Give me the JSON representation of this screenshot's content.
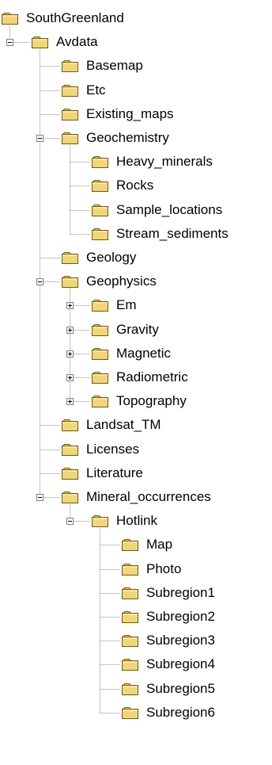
{
  "tree": {
    "colors": {
      "folder_fill": "#f1d678",
      "folder_outline": "#6f5a12",
      "line": "#8a8a8a",
      "text": "#000000"
    },
    "nodes": [
      {
        "label": "SouthGreenland",
        "depth": 0,
        "expander": "none"
      },
      {
        "label": "Avdata",
        "depth": 1,
        "expander": "expanded"
      },
      {
        "label": "Basemap",
        "depth": 2,
        "expander": "none"
      },
      {
        "label": "Etc",
        "depth": 2,
        "expander": "none"
      },
      {
        "label": "Existing_maps",
        "depth": 2,
        "expander": "none"
      },
      {
        "label": "Geochemistry",
        "depth": 2,
        "expander": "expanded"
      },
      {
        "label": "Heavy_minerals",
        "depth": 3,
        "expander": "none"
      },
      {
        "label": "Rocks",
        "depth": 3,
        "expander": "none"
      },
      {
        "label": "Sample_locations",
        "depth": 3,
        "expander": "none"
      },
      {
        "label": "Stream_sediments",
        "depth": 3,
        "expander": "none"
      },
      {
        "label": "Geology",
        "depth": 2,
        "expander": "none"
      },
      {
        "label": "Geophysics",
        "depth": 2,
        "expander": "expanded"
      },
      {
        "label": "Em",
        "depth": 3,
        "expander": "collapsed"
      },
      {
        "label": "Gravity",
        "depth": 3,
        "expander": "collapsed"
      },
      {
        "label": "Magnetic",
        "depth": 3,
        "expander": "collapsed"
      },
      {
        "label": "Radiometric",
        "depth": 3,
        "expander": "collapsed"
      },
      {
        "label": "Topography",
        "depth": 3,
        "expander": "collapsed"
      },
      {
        "label": "Landsat_TM",
        "depth": 2,
        "expander": "none"
      },
      {
        "label": "Licenses",
        "depth": 2,
        "expander": "none"
      },
      {
        "label": "Literature",
        "depth": 2,
        "expander": "none"
      },
      {
        "label": "Mineral_occurrences",
        "depth": 2,
        "expander": "expanded"
      },
      {
        "label": "Hotlink",
        "depth": 3,
        "expander": "expanded"
      },
      {
        "label": "Map",
        "depth": 4,
        "expander": "none"
      },
      {
        "label": "Photo",
        "depth": 4,
        "expander": "none"
      },
      {
        "label": "Subregion1",
        "depth": 4,
        "expander": "none"
      },
      {
        "label": "Subregion2",
        "depth": 4,
        "expander": "none"
      },
      {
        "label": "Subregion3",
        "depth": 4,
        "expander": "none"
      },
      {
        "label": "Subregion4",
        "depth": 4,
        "expander": "none"
      },
      {
        "label": "Subregion5",
        "depth": 4,
        "expander": "none"
      },
      {
        "label": "Subregion6",
        "depth": 4,
        "expander": "none"
      }
    ]
  }
}
